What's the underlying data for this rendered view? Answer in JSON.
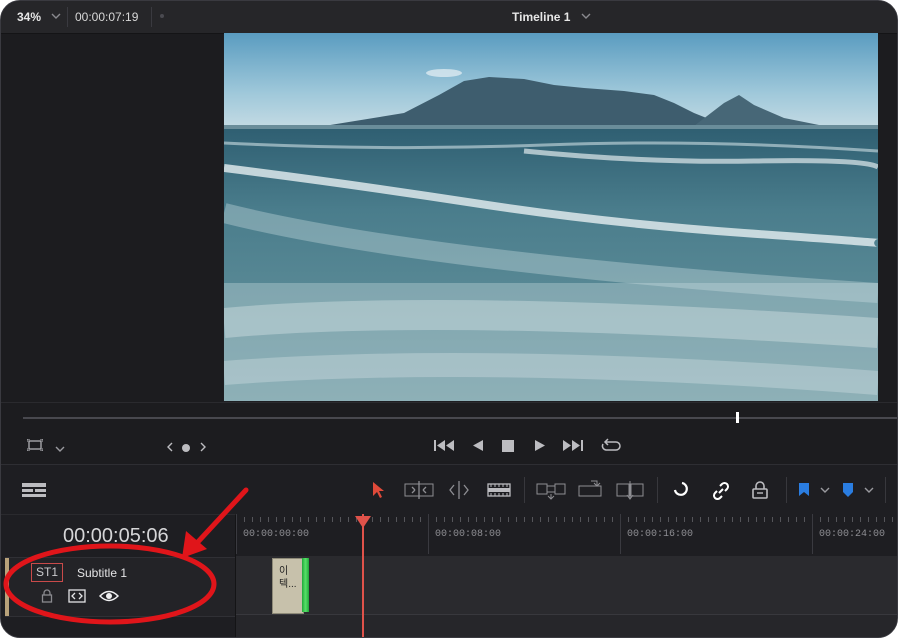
{
  "topbar": {
    "zoom": "34%",
    "timecode": "00:00:07:19",
    "timeline_title": "Timeline 1"
  },
  "timeline": {
    "current_timecode": "00:00:05:06",
    "ruler_labels": [
      "00:00:00:00",
      "00:00:08:00",
      "00:00:16:00",
      "00:00:24:00"
    ],
    "playhead_color": "#e0524a"
  },
  "track": {
    "badge": "ST1",
    "name": "Subtitle 1",
    "accent_color": "#b8a27a",
    "clip_text": "이텍..."
  },
  "colors": {
    "annotation": "#e0151a",
    "flag_blue": "#2a7de1",
    "selection_red": "#e04a3a"
  },
  "icons": {
    "transport": [
      "safe-area-icon",
      "nav-prev-icon",
      "nav-dot-icon",
      "nav-next-icon",
      "skip-start-icon",
      "play-reverse-icon",
      "stop-icon",
      "play-icon",
      "skip-end-icon",
      "loop-icon"
    ],
    "tools": [
      "timeline-view-options-icon",
      "selection-arrow-icon",
      "trim-edit-icon",
      "dynamic-trim-icon",
      "blade-icon",
      "insert-clip-icon",
      "overwrite-clip-icon",
      "replace-clip-icon",
      "snapping-icon",
      "linked-selection-icon",
      "position-lock-icon",
      "flag-icon",
      "marker-icon"
    ],
    "track_controls": [
      "lock-icon",
      "auto-select-icon",
      "visibility-eye-icon"
    ]
  }
}
